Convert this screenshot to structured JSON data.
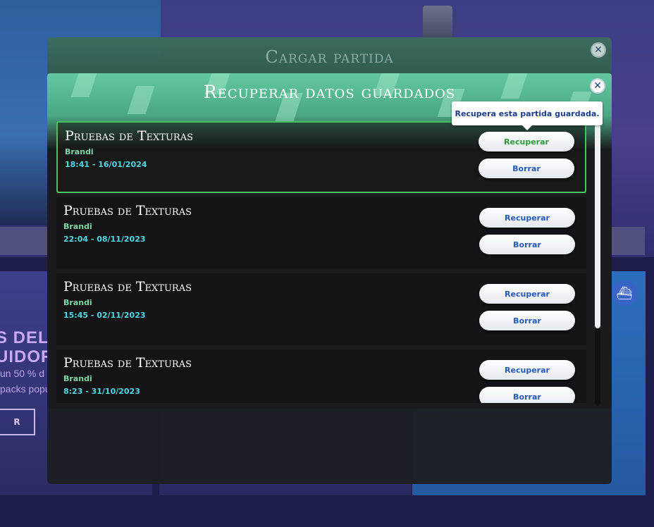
{
  "background": {
    "promo_title_line1": "S DEL",
    "promo_title_line2": "UIDOR",
    "promo_line1": "un 50 % d",
    "promo_line2": "packs popu",
    "promo_button": "R"
  },
  "outer_dialog": {
    "title": "Cargar partida",
    "close_label": "✕"
  },
  "inner_dialog": {
    "title": "Recuperar datos guardados",
    "close_label": "✕"
  },
  "tooltip": "Recupera esta partida guardada.",
  "saves": [
    {
      "name": "Pruebas de Texturas",
      "user": "Brandi",
      "date": "18:41 - 16/01/2024",
      "recover": "Recuperar",
      "delete": "Borrar"
    },
    {
      "name": "Pruebas de Texturas",
      "user": "Brandi",
      "date": "22:04 - 08/11/2023",
      "recover": "Recuperar",
      "delete": "Borrar"
    },
    {
      "name": "Pruebas de Texturas",
      "user": "Brandi",
      "date": "15:45 - 02/11/2023",
      "recover": "Recuperar",
      "delete": "Borrar"
    },
    {
      "name": "Pruebas de Texturas",
      "user": "Brandi",
      "date": "8:23 - 31/10/2023",
      "recover": "Recuperar",
      "delete": "Borrar"
    }
  ],
  "colors": {
    "header_green": "#4aa884",
    "selected_border": "#47c25c",
    "user_text": "#7ed6a6",
    "date_text": "#4fd9e6",
    "button_text": "#2659b8",
    "hover_button_text": "#2a9a3a"
  }
}
